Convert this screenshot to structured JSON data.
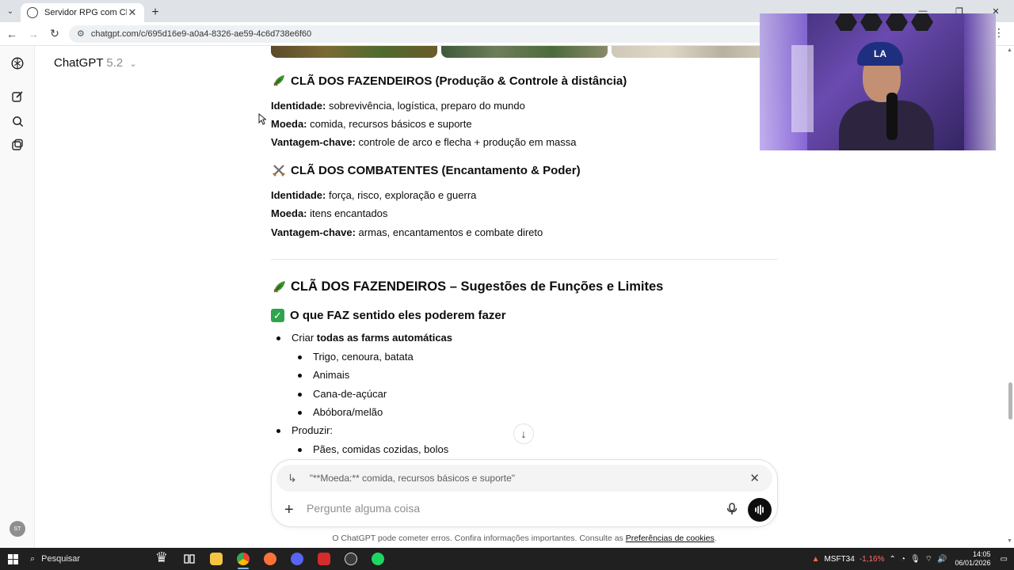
{
  "browser": {
    "tab_title": "Servidor RPG com Clãs",
    "url": "chatgpt.com/c/695d16e9-a0a4-8326-ae59-4c6d738e6f60"
  },
  "header": {
    "model_name": "ChatGPT",
    "model_version": "5.2"
  },
  "sidebar": {
    "avatar_initials": "ST"
  },
  "conversation": {
    "section1": {
      "title": "CLÃ DOS FAZENDEIROS (Produção & Controle à distância)",
      "identity_label": "Identidade:",
      "identity_value": " sobrevivência, logística, preparo do mundo",
      "currency_label": "Moeda:",
      "currency_value": " comida, recursos básicos e suporte",
      "advantage_label": "Vantagem-chave:",
      "advantage_value": " controle de arco e flecha + produção em massa"
    },
    "section2": {
      "title": "CLÃ DOS COMBATENTES (Encantamento & Poder)",
      "identity_label": "Identidade:",
      "identity_value": " força, risco, exploração e guerra",
      "currency_label": "Moeda:",
      "currency_value": " itens encantados",
      "advantage_label": "Vantagem-chave:",
      "advantage_value": " armas, encantamentos e combate direto"
    },
    "section3": {
      "title": "CLÃ DOS FAZENDEIROS – Sugestões de Funções e Limites",
      "subtitle": "O que FAZ sentido eles poderem fazer",
      "bullet1_prefix": "Criar ",
      "bullet1_bold": "todas as farms automáticas",
      "sub_items": [
        "Trigo, cenoura, batata",
        "Animais",
        "Cana-de-açúcar",
        "Abóbora/melão"
      ],
      "bullet2": "Produzir:",
      "sub_items2": [
        "Pães, comidas cozidas, bolos"
      ]
    }
  },
  "composer": {
    "quote_text": "\"**Moeda:** comida, recursos básicos e suporte\"",
    "placeholder": "Pergunte alguma coisa",
    "disclaimer": "O ChatGPT pode cometer erros. Confira informações importantes. Consulte as ",
    "disclaimer_link": "Preferências de cookies",
    "disclaimer_end": "."
  },
  "taskbar": {
    "search_label": "Pesquisar",
    "stock_symbol": "MSFT34",
    "stock_change": "-1,16%",
    "time": "14:05",
    "date": "06/01/2026"
  },
  "colors": {
    "accent_green": "#2ea44f",
    "taskbar_bg": "#202020",
    "stock_negative": "#ff6b6b"
  }
}
